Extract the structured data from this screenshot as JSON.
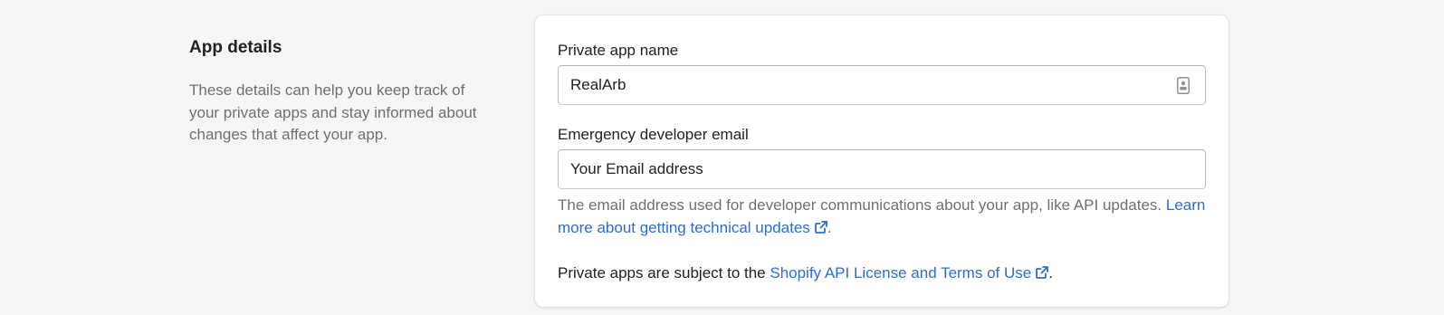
{
  "annotation": {
    "title": "App details",
    "description": "These details can help you keep track of your private apps and stay informed about changes that affect your app."
  },
  "app_name": {
    "label": "Private app name",
    "value": "RealArb",
    "icon": "contact-card-icon"
  },
  "developer_email": {
    "label": "Emergency developer email",
    "value": "Your Email address",
    "help_text": "The email address used for developer communications about your app, like API updates. ",
    "help_link": "Learn more about getting technical updates",
    "help_suffix": "."
  },
  "terms": {
    "prefix": "Private apps are subject to the ",
    "link": "Shopify API License and Terms of Use",
    "suffix": "."
  },
  "colors": {
    "background": "#f6f6f7",
    "card": "#ffffff",
    "link": "#2c6ecb",
    "subdued_text": "#6d7175",
    "text": "#202223"
  }
}
